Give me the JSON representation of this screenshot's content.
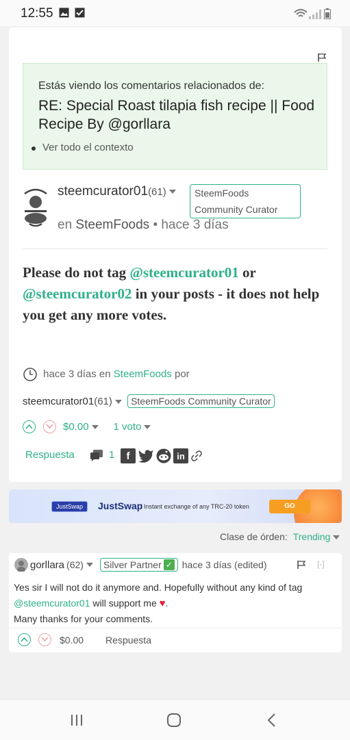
{
  "status": {
    "time": "12:55"
  },
  "context": {
    "label": "Estás viendo los comentarios relacionados de:",
    "title": "RE: Special Roast tilapia fish recipe || Food Recipe By @gorllara",
    "link": "Ver todo el contexto"
  },
  "post": {
    "author": "steemcurator01",
    "rep": "(61)",
    "badge": "SteemFoods Community Curator",
    "in_prefix": "en",
    "community": "SteemFoods",
    "time": "• hace 3 días",
    "body": {
      "p1": "Please do not tag ",
      "m1": "@steemcurator01",
      "p2": " or ",
      "m2": "@steemcurator02",
      "p3": " in your posts - it does not help you get any more votes."
    },
    "meta_time": "hace 3 días en",
    "meta_community": "SteemFoods",
    "meta_por": "por",
    "author2": "steemcurator01",
    "rep2": "(61)",
    "badge2": "SteemFoods Community Curator",
    "payout": "$0.00",
    "votes": "1 voto",
    "reply": "Respuesta",
    "comments": "1"
  },
  "ad": {
    "tag": "JustSwap",
    "brand": "JustSwap",
    "desc": "/ Instant exchange of any TRC-20 token",
    "cta": "GO"
  },
  "sort": {
    "label": "Clase de órden:",
    "value": "Trending"
  },
  "reply": {
    "author": "gorllara",
    "rep": "(62)",
    "badge": "Silver Partner",
    "time": "hace 3 días (edited)",
    "collapse": "[-]",
    "line1": "Yes sir I will not do it anymore and. Hopefully without any kind of tag",
    "mention": "@steemcurator01",
    "line2": " will support me",
    "line3": "Many thanks for your comments.",
    "payout": "$0.00",
    "reply_label": "Respuesta"
  },
  "icons": {
    "flag": "flag-icon",
    "clock": "clock-icon",
    "upvote": "upvote-icon",
    "downvote": "downvote-icon",
    "comments": "comments-icon",
    "facebook": "facebook-icon",
    "twitter": "twitter-icon",
    "reddit": "reddit-icon",
    "linkedin": "linkedin-icon",
    "link": "link-icon"
  },
  "colors": {
    "accent": "#2fb08a",
    "context_bg": "#eaf7ea",
    "downvote": "#e8a0a0"
  }
}
